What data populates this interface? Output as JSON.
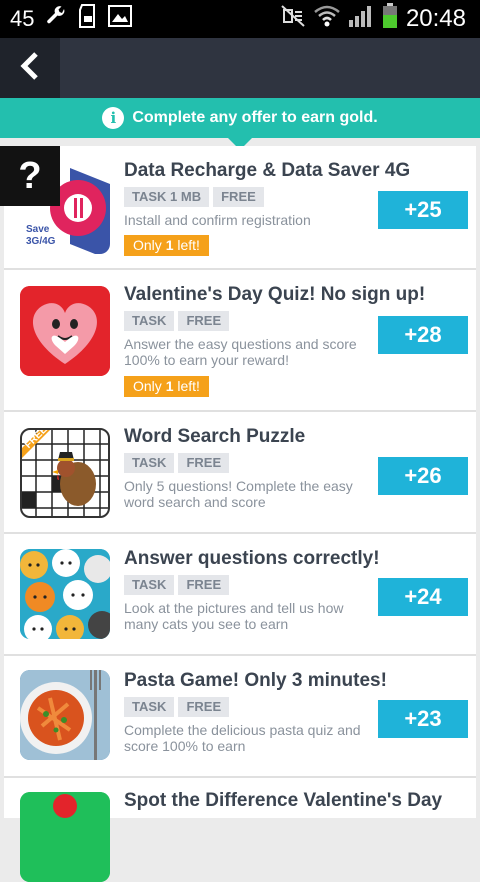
{
  "status_bar": {
    "signal_text": "45",
    "time": "20:48",
    "battery_color": "#4dcb2e"
  },
  "banner": {
    "text": "Complete any offer to earn gold."
  },
  "help_label": "?",
  "offers": [
    {
      "title": "Data Recharge & Data Saver 4G",
      "tags": [
        "TASK 1 MB",
        "FREE"
      ],
      "description": "Install and confirm registration",
      "only_left": {
        "prefix": "Only ",
        "count": "1",
        "suffix": " left!"
      },
      "reward": "+25",
      "thumb_text": "Save\n3G/4G"
    },
    {
      "title": "Valentine's Day Quiz! No sign up!",
      "tags": [
        "TASK",
        "FREE"
      ],
      "description": "Answer the easy questions and score 100% to earn your reward!",
      "only_left": {
        "prefix": "Only ",
        "count": "1",
        "suffix": " left!"
      },
      "reward": "+28"
    },
    {
      "title": "Word Search Puzzle",
      "tags": [
        "TASK",
        "FREE"
      ],
      "description": "Only 5 questions! Complete the easy word search and score",
      "reward": "+26",
      "thumb_badge": "FREE"
    },
    {
      "title": "Answer questions correctly!",
      "tags": [
        "TASK",
        "FREE"
      ],
      "description": "Look at the pictures and tell us how many cats you see to earn",
      "reward": "+24"
    },
    {
      "title": "Pasta Game! Only 3 minutes!",
      "tags": [
        "TASK",
        "FREE"
      ],
      "description": "Complete the delicious pasta quiz and score 100% to earn",
      "reward": "+23"
    },
    {
      "title": "Spot the Difference Valentine's Day"
    }
  ]
}
